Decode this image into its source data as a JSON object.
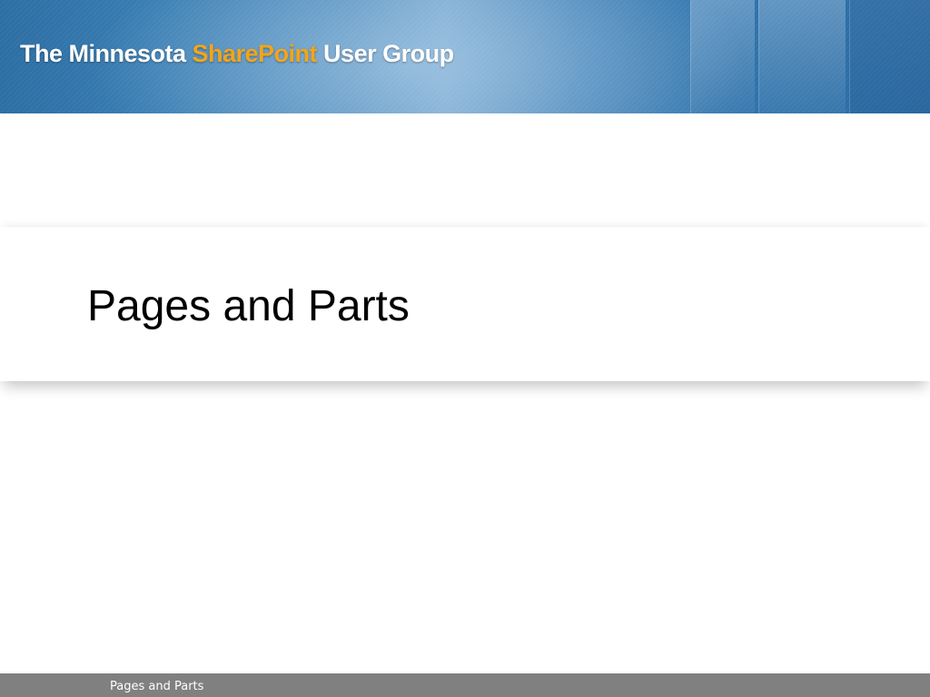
{
  "header": {
    "title_prefix": "The Minnesota ",
    "title_accent": "SharePoint",
    "title_suffix": " User Group",
    "accent_color": "#f2a51a"
  },
  "slide": {
    "title": "Pages and Parts"
  },
  "footer": {
    "text": "Pages and Parts"
  }
}
